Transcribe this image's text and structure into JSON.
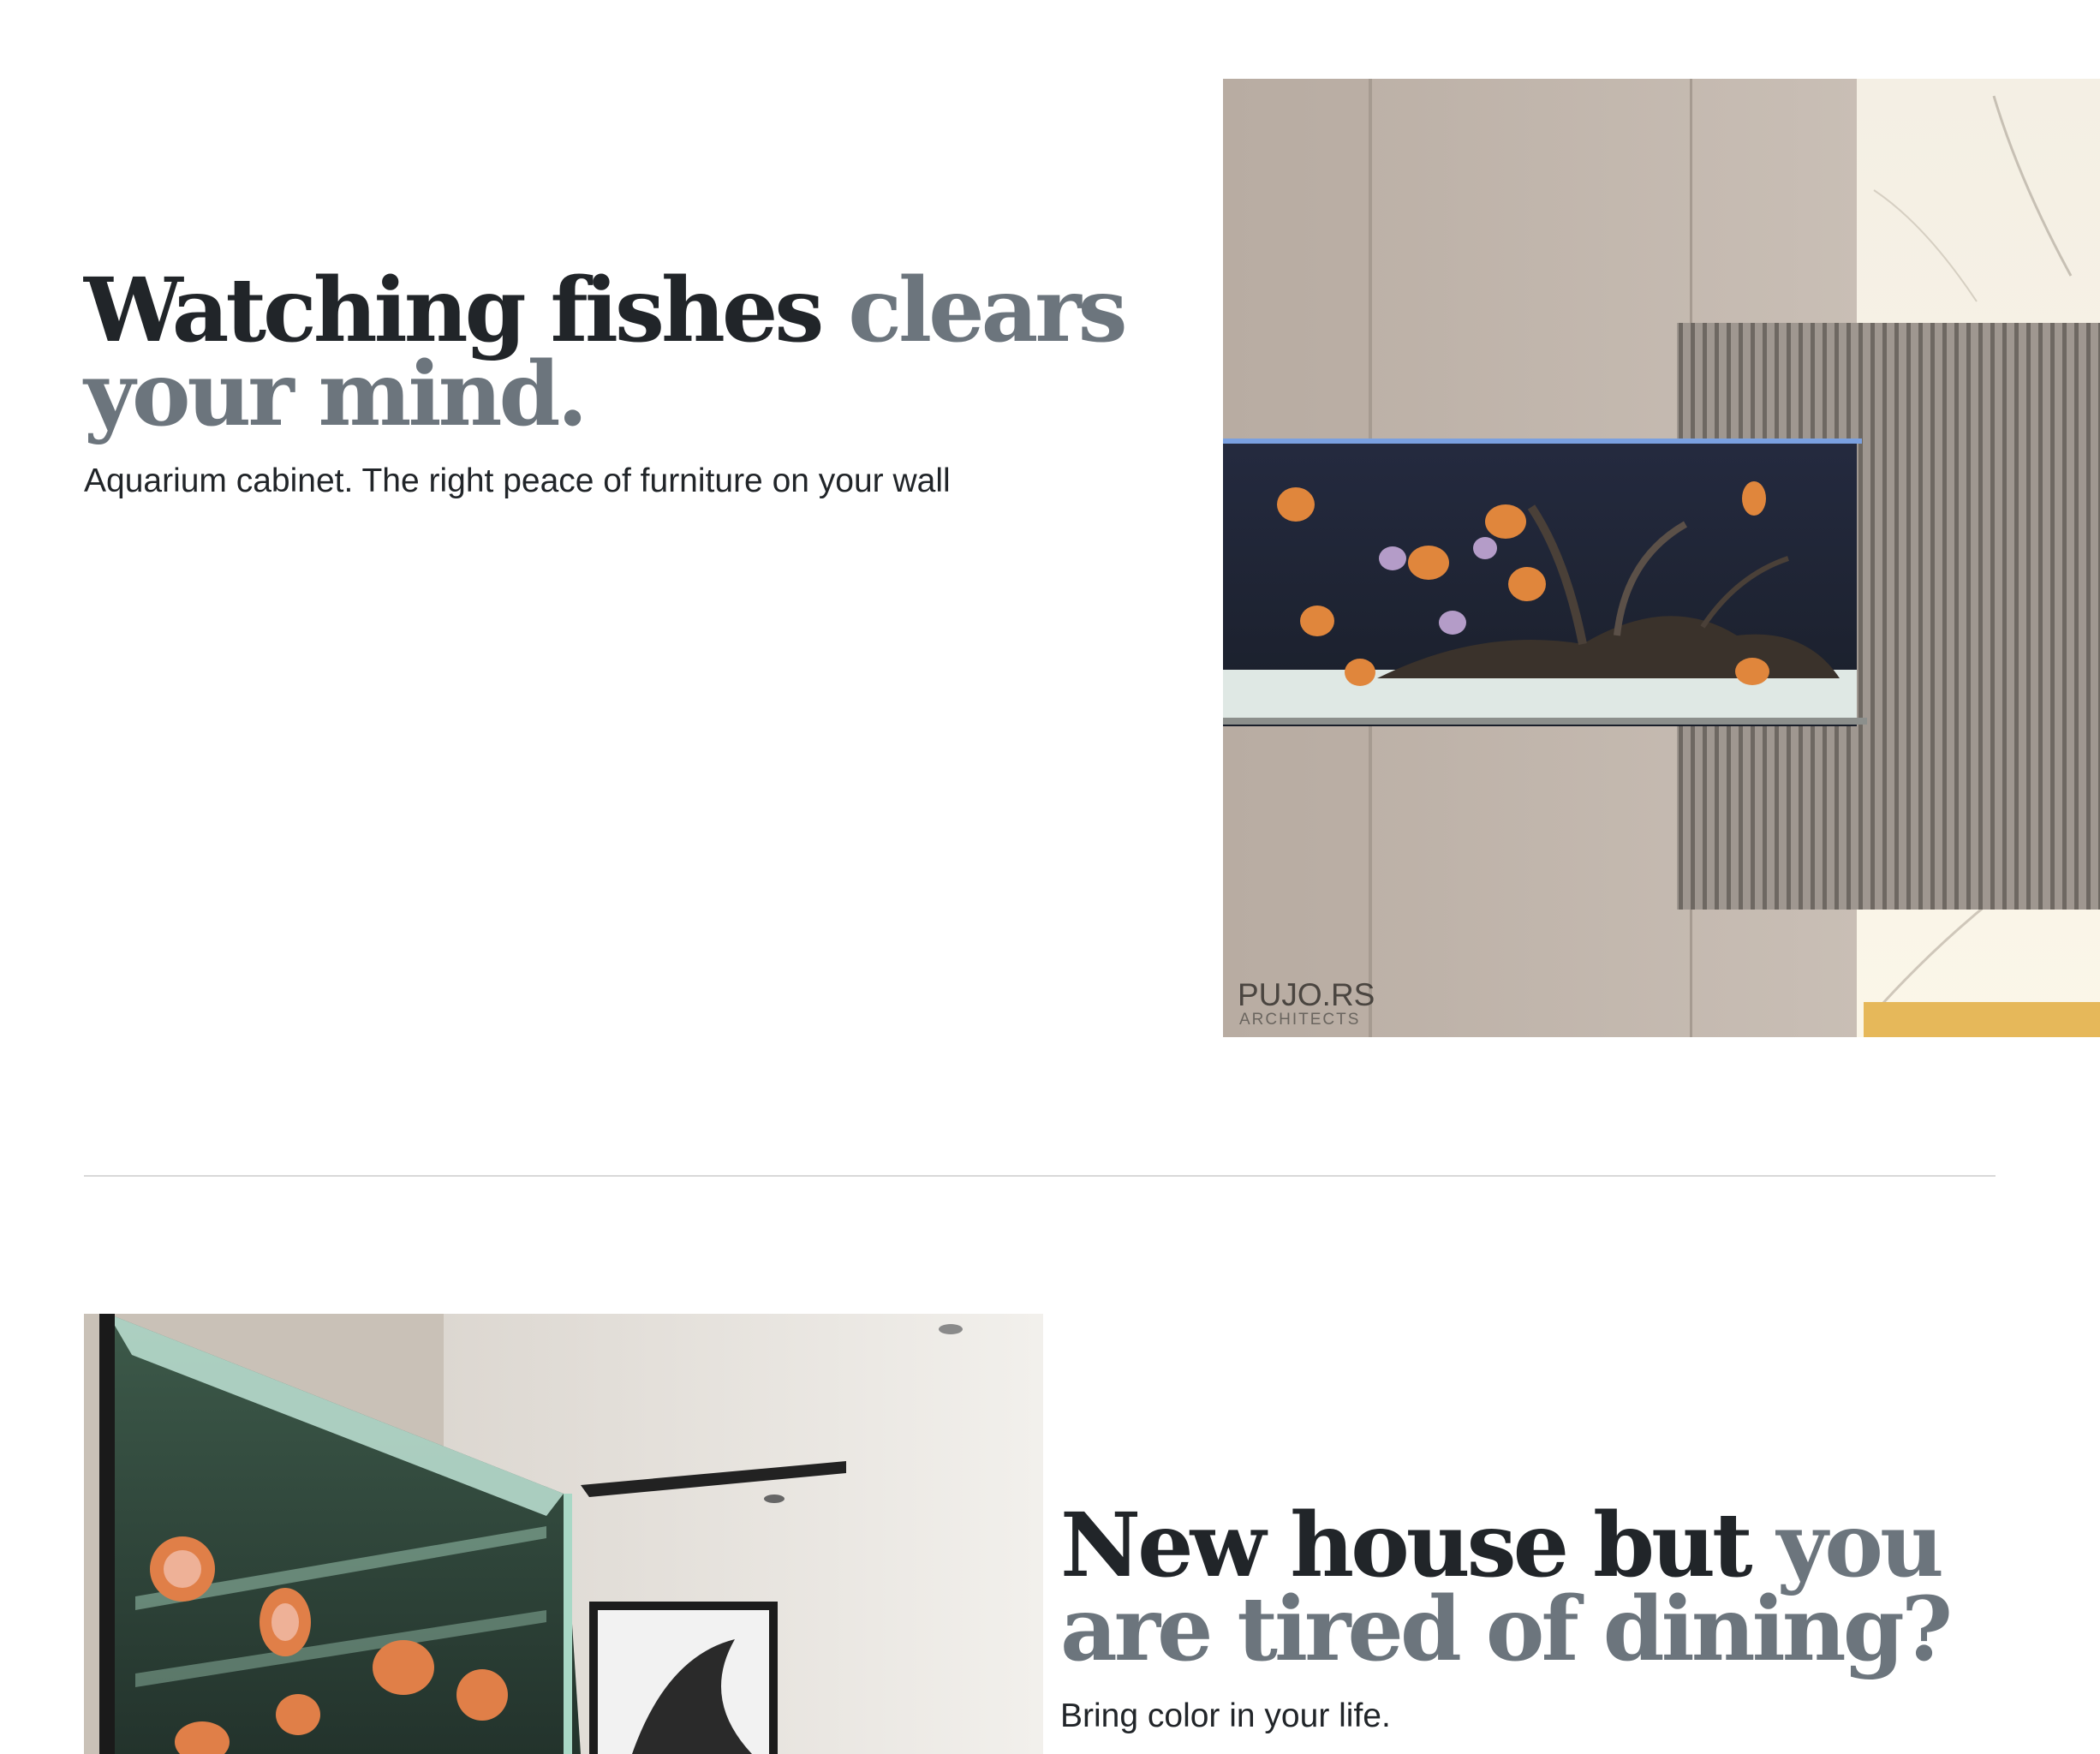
{
  "feature1": {
    "heading_main": "Watching fishes ",
    "heading_muted": "clears your mind.",
    "lead": "Aquarium cabinet. The right peace of furniture on your wall",
    "image_watermark_main": "PUJO.RS",
    "image_watermark_sub": "ARCHITECTS"
  },
  "feature2": {
    "heading_main": "New house but ",
    "heading_muted": "you are tired of dining?",
    "lead": "Bring color in your life."
  },
  "colors": {
    "heading": "#212529",
    "muted": "#6c757d",
    "divider": "#d9d9d9"
  }
}
